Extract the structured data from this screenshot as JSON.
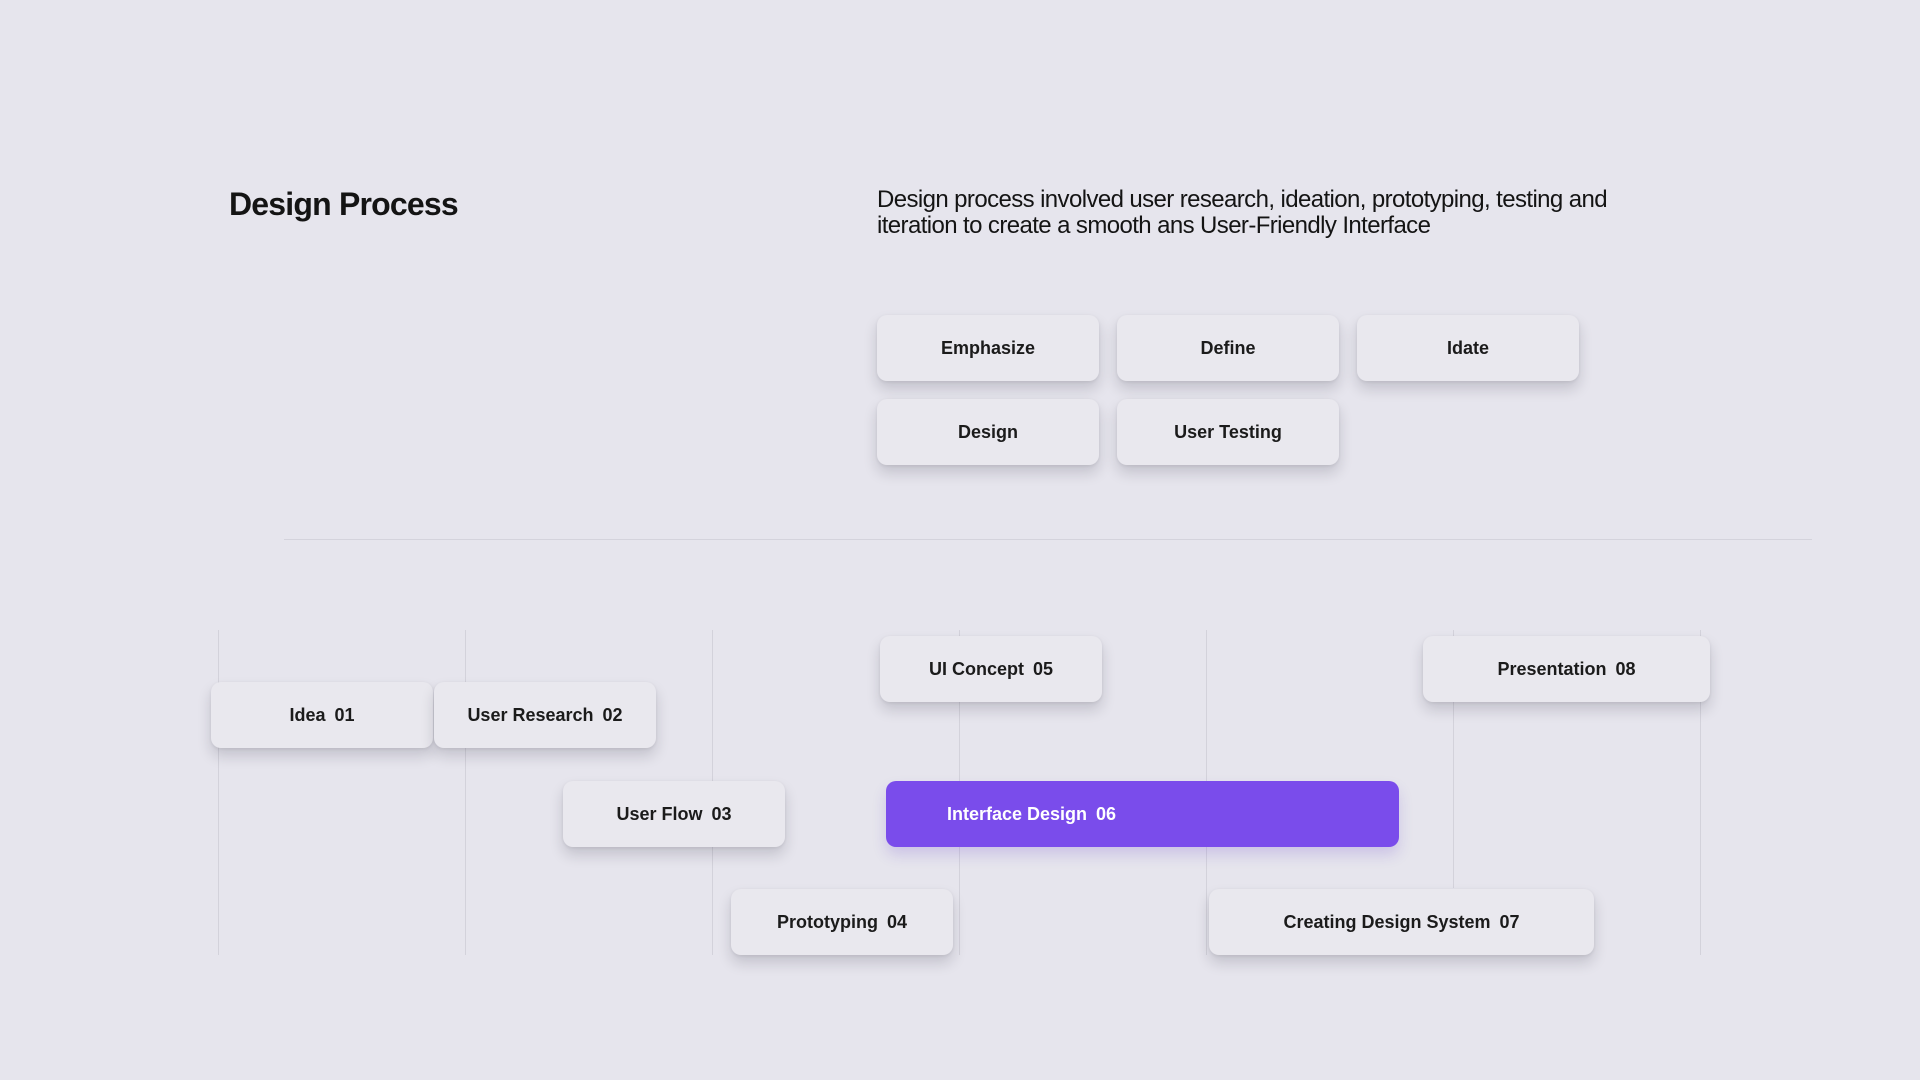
{
  "header": {
    "title": "Design Process",
    "description": "Design process involved user research, ideation, prototyping, testing and iteration to create a smooth ans User-Friendly Interface"
  },
  "phases": [
    "Emphasize",
    "Define",
    "Idate",
    "Design",
    "User Testing"
  ],
  "timeline": [
    {
      "label": "Idea",
      "num": "01"
    },
    {
      "label": "User Research",
      "num": "02"
    },
    {
      "label": "User Flow",
      "num": "03"
    },
    {
      "label": "Prototyping",
      "num": "04"
    },
    {
      "label": "UI Concept",
      "num": "05"
    },
    {
      "label": "Interface Design",
      "num": "06"
    },
    {
      "label": "Creating Design System",
      "num": "07"
    },
    {
      "label": "Presentation",
      "num": "08"
    }
  ],
  "colors": {
    "background": "#e6e5ed",
    "accent": "#7a4ceb",
    "text": "#141414"
  }
}
